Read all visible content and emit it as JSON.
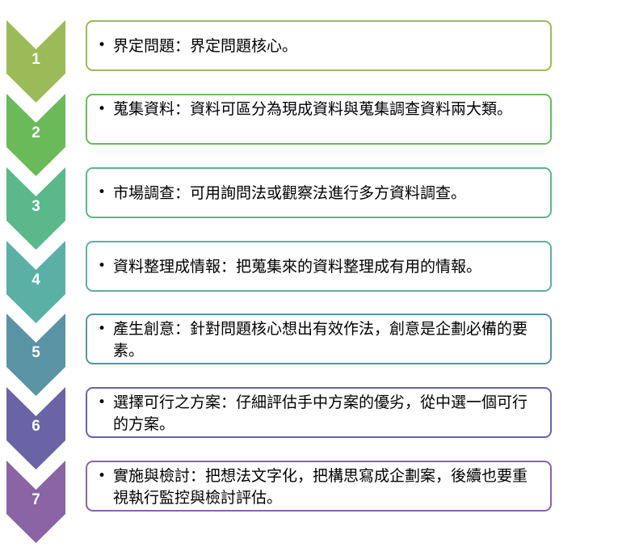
{
  "steps": [
    {
      "number": "1",
      "text": "界定問題：界定問題核心。",
      "color": "#9bbb59"
    },
    {
      "number": "2",
      "text": "蒐集資料：資料可區分為現成資料與蒐集調查資料兩大類。",
      "color": "#6aba5a"
    },
    {
      "number": "3",
      "text": "市場調查：可用詢問法或觀察法進行多方資料調查。",
      "color": "#5ab88a"
    },
    {
      "number": "4",
      "text": "資料整理成情報：把蒐集來的資料整理成有用的情報。",
      "color": "#5ab0a4"
    },
    {
      "number": "5",
      "text": "產生創意：針對問題核心想出有效作法，創意是企劃必備的要素。",
      "color": "#5a94a4"
    },
    {
      "number": "6",
      "text": "選擇可行之方案：仔細評估手中方案的優劣，從中選一個可行的方案。",
      "color": "#6a64a6"
    },
    {
      "number": "7",
      "text": "實施與檢討：把想法文字化，把構思寫成企劃案，後續也要重視執行監控與檢討評估。",
      "color": "#8a64a4"
    }
  ],
  "bullet": "•"
}
